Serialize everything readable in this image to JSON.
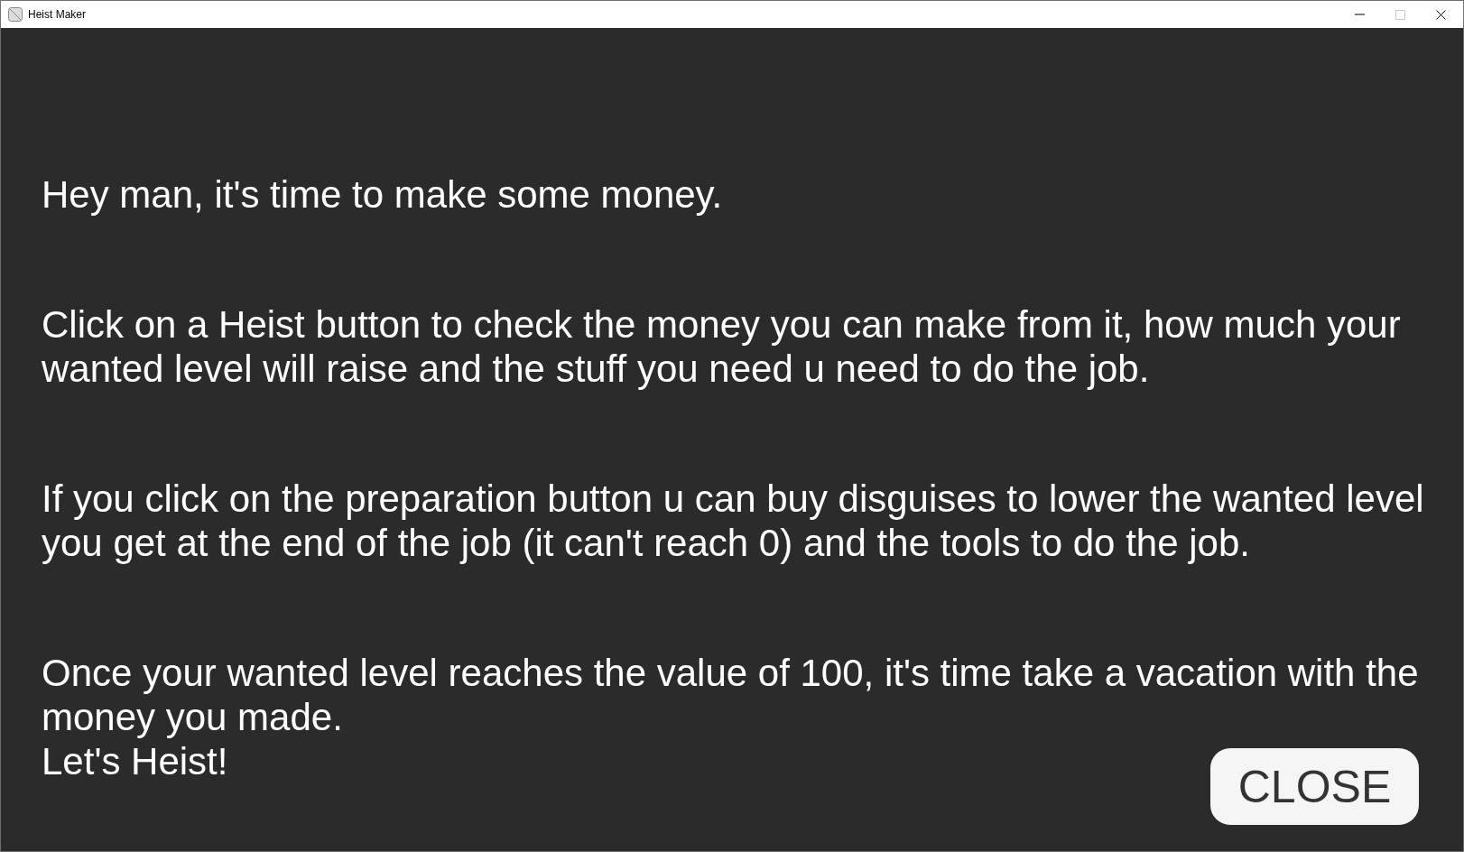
{
  "window": {
    "title": "Heist Maker",
    "controls": [
      {
        "kind": "minimize",
        "disabled": false
      },
      {
        "kind": "maximize",
        "disabled": true
      },
      {
        "kind": "close",
        "disabled": false
      }
    ]
  },
  "paragraphs": [
    "Hey man, it's time to make some money.",
    "Click on a Heist button to check the money you can make from it, how much your wanted level will raise and the stuff you need u need to do the job.",
    "If you click on the preparation button u can buy disguises to lower the wanted level you get at the end of the job (it can't reach 0) and the tools to do the job.",
    "Once your wanted level reaches the value of 100, it's time take a vacation with the money you made."
  ],
  "closing_line": "Let's Heist!",
  "close_button": {
    "label": "CLOSE"
  }
}
